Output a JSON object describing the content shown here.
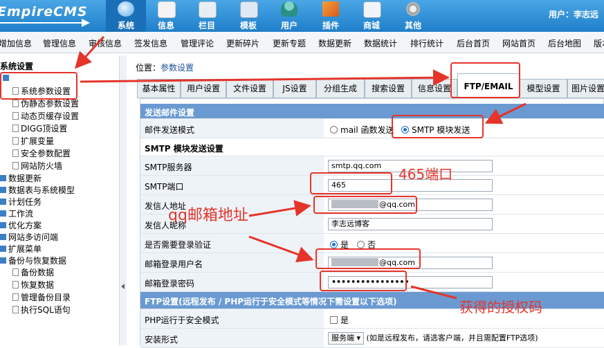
{
  "logo": "EmpireCMS",
  "nav": [
    {
      "label": "系统",
      "icon": "system-icon",
      "active": true
    },
    {
      "label": "信息",
      "icon": "info-icon"
    },
    {
      "label": "栏目",
      "icon": "column-icon"
    },
    {
      "label": "模板",
      "icon": "template-icon"
    },
    {
      "label": "用户",
      "icon": "user-icon"
    },
    {
      "label": "插件",
      "icon": "plugin-icon"
    },
    {
      "label": "商城",
      "icon": "shop-icon"
    },
    {
      "label": "其他",
      "icon": "gear-icon"
    }
  ],
  "user": "用户：李志远",
  "submenu": [
    "增加信息",
    "管理信息",
    "审核信息",
    "签发信息",
    "管理评论",
    "更新碎片",
    "更新专题",
    "数据更新",
    "数据统计",
    "排行统计",
    "后台首页",
    "网站首页",
    "后台地图",
    "版本"
  ],
  "sidebar": {
    "root": "系统设置",
    "items": [
      {
        "label": "系统参数设置",
        "type": "doc"
      },
      {
        "label": "伪静态参数设置",
        "type": "doc"
      },
      {
        "label": "动态页缓存设置",
        "type": "doc"
      },
      {
        "label": "DIGG顶设置",
        "type": "doc"
      },
      {
        "label": "扩展变量",
        "type": "doc"
      },
      {
        "label": "安全参数配置",
        "type": "doc"
      },
      {
        "label": "网站防火墙",
        "type": "doc"
      }
    ],
    "groups": [
      "数据更新",
      "数据表与系统模型",
      "计划任务",
      "工作流",
      "优化方案",
      "网站多访问端",
      "扩展菜单",
      "备份与恢复数据"
    ],
    "backup_items": [
      "备份数据",
      "恢复数据",
      "管理备份目录",
      "执行SQL语句"
    ]
  },
  "breadcrumb": {
    "prefix": "位置：",
    "link": "参数设置"
  },
  "tabs": [
    "基本属性",
    "用户设置",
    "文件设置",
    "JS设置",
    "分组生成",
    "搜索设置",
    "信息设置",
    "FTP/EMAIL",
    "模型设置",
    "图片设置"
  ],
  "active_tab": "FTP/EMAIL",
  "form": {
    "section_email": "发送邮件设置",
    "send_mode_label": "邮件发送模式",
    "send_mode_options": [
      "mail 函数发送",
      "SMTP 模块发送"
    ],
    "smtp_section": "SMTP 模块发送设置",
    "smtp_server_label": "SMTP服务器",
    "smtp_server_value": "smtp.qq.com",
    "smtp_port_label": "SMTP端口",
    "smtp_port_value": "465",
    "sender_addr_label": "发信人地址",
    "sender_addr_suffix": "@qq.com",
    "sender_name_label": "发信人昵称",
    "sender_name_value": "李志远博客",
    "need_login_label": "是否需要登录验证",
    "need_login_yes": "是",
    "need_login_no": "否",
    "login_user_label": "邮箱登录用户名",
    "login_user_suffix": "@qq.com",
    "login_pass_label": "邮箱登录密码",
    "login_pass_value": "••••••••••••••••",
    "ftp_section": "FTP设置(远程发布 / PHP运行于安全模式等情况下需设置以下选项)",
    "php_safe_label": "PHP运行于安全模式",
    "php_safe_yes": "是",
    "install_label": "安装形式",
    "install_select": "服务端",
    "install_hint": "(如是远程发布，请选客户端，并且需配置FTP选项)"
  },
  "annotations": {
    "port": "465端口",
    "qq_addr": "qq邮箱地址",
    "auth_code": "获得的授权码"
  },
  "colors": {
    "accent": "#2f8fd6",
    "annotation": "#e5342a",
    "section_header": "#6a9ad1"
  }
}
